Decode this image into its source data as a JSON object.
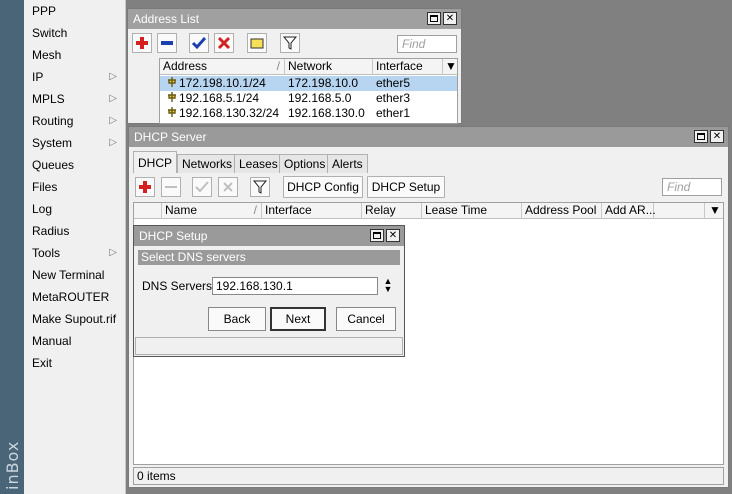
{
  "app": {
    "vertical_label": "inBox"
  },
  "sidebar": {
    "items": [
      {
        "label": "PPP",
        "submenu": false
      },
      {
        "label": "Switch",
        "submenu": false
      },
      {
        "label": "Mesh",
        "submenu": false
      },
      {
        "label": "IP",
        "submenu": true
      },
      {
        "label": "MPLS",
        "submenu": true
      },
      {
        "label": "Routing",
        "submenu": true
      },
      {
        "label": "System",
        "submenu": true
      },
      {
        "label": "Queues",
        "submenu": false
      },
      {
        "label": "Files",
        "submenu": false
      },
      {
        "label": "Log",
        "submenu": false
      },
      {
        "label": "Radius",
        "submenu": false
      },
      {
        "label": "Tools",
        "submenu": true
      },
      {
        "label": "New Terminal",
        "submenu": false
      },
      {
        "label": "MetaROUTER",
        "submenu": false
      },
      {
        "label": "Make Supout.rif",
        "submenu": false
      },
      {
        "label": "Manual",
        "submenu": false
      },
      {
        "label": "Exit",
        "submenu": false
      }
    ]
  },
  "address_list": {
    "title": "Address List",
    "find_placeholder": "Find",
    "columns": [
      "Address",
      "Network",
      "Interface"
    ],
    "rows": [
      {
        "address": "172.198.10.1/24",
        "network": "172.198.10.0",
        "interface": "ether5",
        "selected": true
      },
      {
        "address": "192.168.5.1/24",
        "network": "192.168.5.0",
        "interface": "ether3",
        "selected": false
      },
      {
        "address": "192.168.130.32/24",
        "network": "192.168.130.0",
        "interface": "ether1",
        "selected": false
      }
    ]
  },
  "dhcp_server": {
    "title": "DHCP Server",
    "tabs": [
      "DHCP",
      "Networks",
      "Leases",
      "Options",
      "Alerts"
    ],
    "active_tab": "DHCP",
    "buttons": {
      "config": "DHCP Config",
      "setup": "DHCP Setup"
    },
    "find_placeholder": "Find",
    "columns": [
      "Name",
      "Interface",
      "Relay",
      "Lease Time",
      "Address Pool",
      "Add AR..."
    ],
    "status": "0 items"
  },
  "dhcp_setup": {
    "title": "DHCP Setup",
    "step_text": "Select DNS servers",
    "field_label": "DNS Servers:",
    "field_value": "192.168.130.1",
    "buttons": {
      "back": "Back",
      "next": "Next",
      "cancel": "Cancel"
    }
  },
  "colors": {
    "selection": "#b7d4f0",
    "title_bar": "#a0a0a0",
    "add_red": "#d42020",
    "check_blue": "#1c3fb0",
    "strip": "#4a6478"
  }
}
